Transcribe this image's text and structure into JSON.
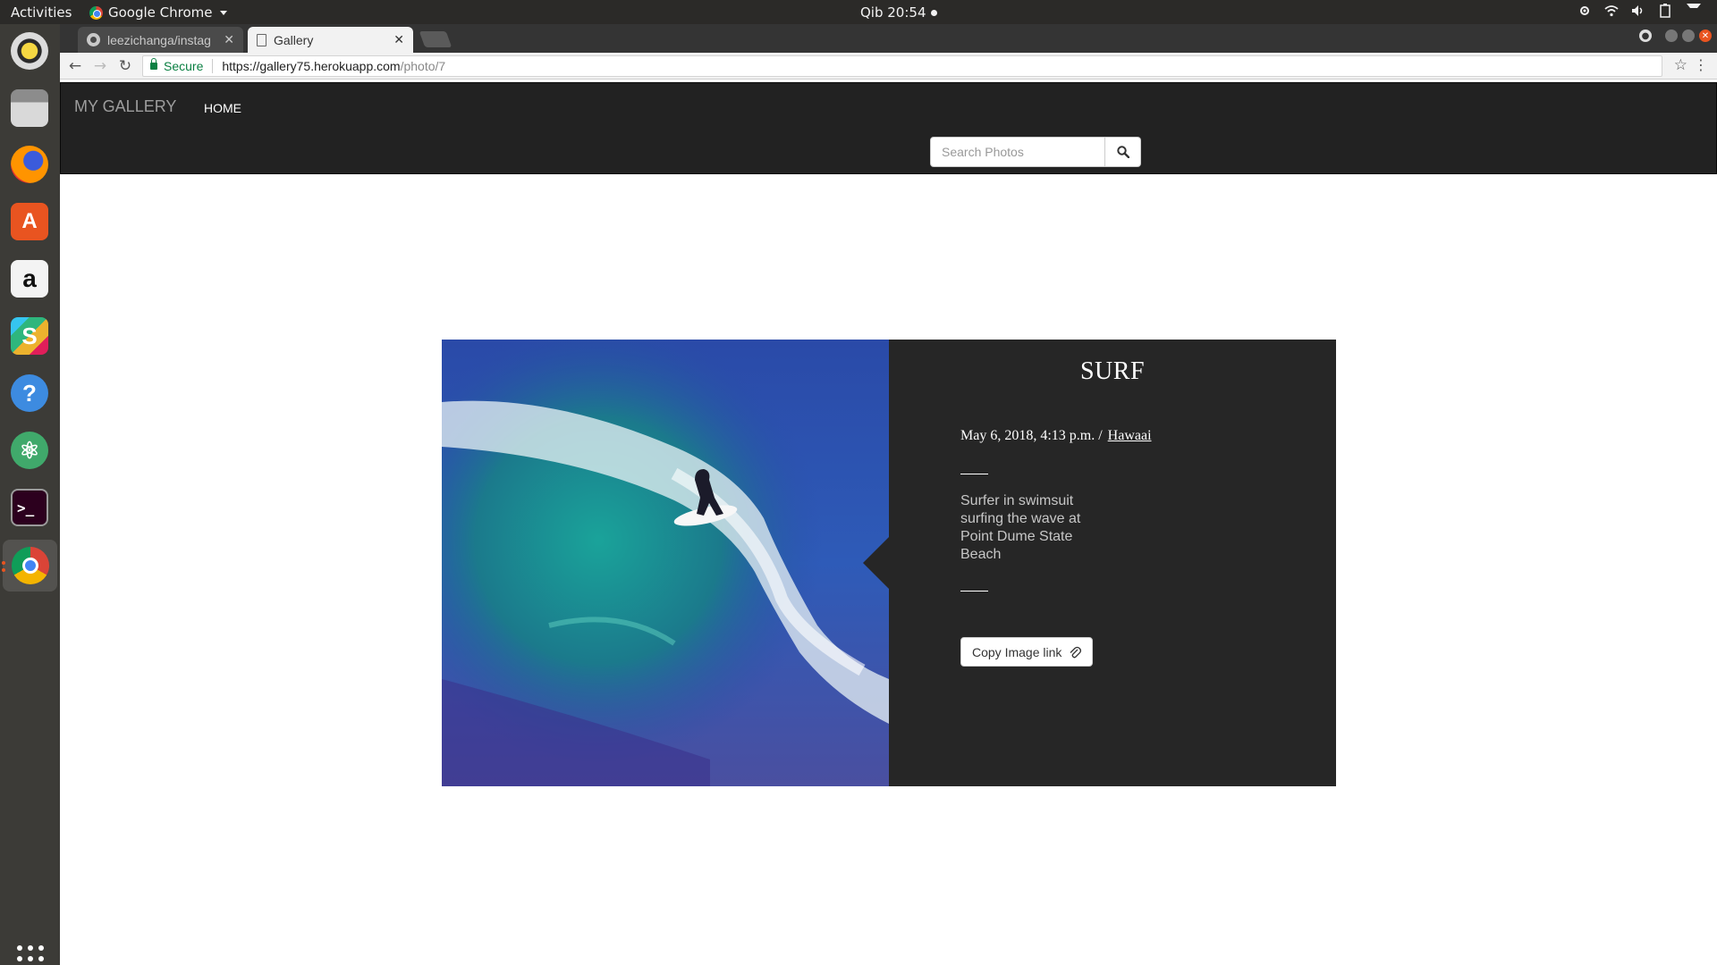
{
  "system": {
    "activities_label": "Activities",
    "app_menu_label": "Google Chrome",
    "clock": "Qib 20:54"
  },
  "dock": {
    "apps": [
      "rhythmbox-icon",
      "files-icon",
      "firefox-icon",
      "software-center-icon",
      "amazon-icon",
      "slack-icon",
      "help-icon",
      "atom-icon",
      "terminal-icon",
      "chrome-icon"
    ]
  },
  "browser": {
    "tabs": [
      {
        "title": "leezichanga/instag"
      },
      {
        "title": "Gallery"
      }
    ],
    "secure_label": "Secure",
    "url_host": "https://gallery75.herokuapp.com",
    "url_path": "/photo/7"
  },
  "site": {
    "brand": "MY GALLERY",
    "nav_home": "HOME",
    "search_placeholder": "Search Photos"
  },
  "photo": {
    "title": "SURF",
    "date": "May 6, 2018, 4:13 p.m. /",
    "location": "Hawaai",
    "description": "Surfer in swimsuit surfing the wave at Point Dume State Beach",
    "copy_label": "Copy Image link"
  }
}
